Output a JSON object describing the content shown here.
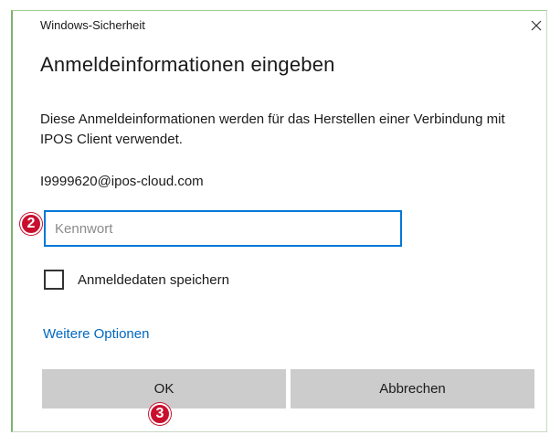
{
  "window": {
    "title": "Windows-Sicherheit",
    "close_glyph": "✕",
    "close_icon": "close-icon"
  },
  "dialog": {
    "heading": "Anmeldeinformationen eingeben",
    "description": "Diese Anmeldeinformationen werden für das Herstellen einer Verbindung mit IPOS Client verwendet.",
    "account": "I9999620@ipos-cloud.com"
  },
  "password": {
    "placeholder": "Kennwort",
    "value": ""
  },
  "remember": {
    "label": "Anmeldedaten speichern",
    "checked": false
  },
  "more_options": {
    "label": "Weitere Optionen"
  },
  "buttons": {
    "ok": "OK",
    "cancel": "Abbrechen"
  },
  "markers": {
    "step2": "2",
    "step3": "3"
  },
  "colors": {
    "accent": "#0078d7",
    "link": "#0067c0",
    "marker": "#c8102e",
    "button_bg": "#cccccc",
    "frame_green": "#7cb46a"
  }
}
